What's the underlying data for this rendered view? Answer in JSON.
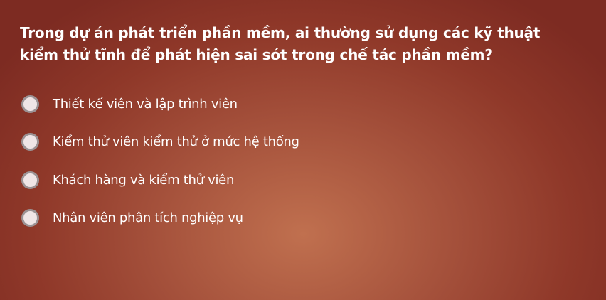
{
  "question": {
    "text": "Trong dự án phát triển phần mềm, ai thường sử dụng các kỹ thuật kiểm thử tĩnh để phát hiện sai sót trong chế tác phần mềm?"
  },
  "options": [
    {
      "label": "Thiết kế viên và lập trình viên",
      "selected": false
    },
    {
      "label": "Kiểm thử viên kiểm thử ở mức hệ thống",
      "selected": false
    },
    {
      "label": "Khách hàng và kiểm thử viên",
      "selected": false
    },
    {
      "label": "Nhân viên phân tích nghiệp vụ",
      "selected": false
    }
  ]
}
